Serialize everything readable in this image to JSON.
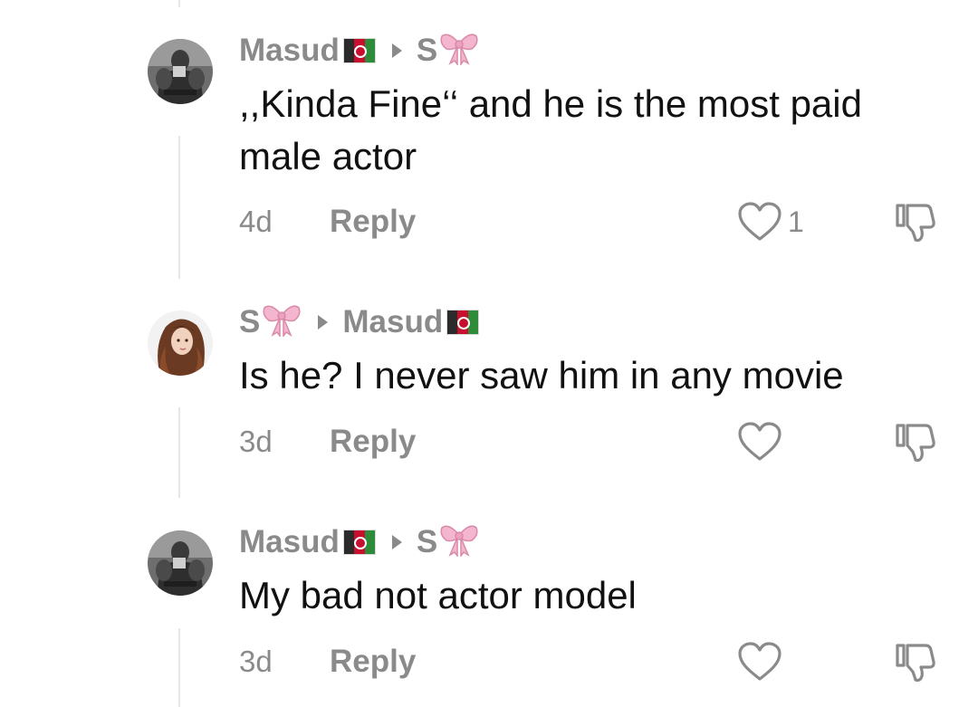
{
  "comments": [
    {
      "author": "Masud",
      "reply_to": "S",
      "author_flag_icon": "afghanistan-flag-icon",
      "reply_to_icon": "pink-bow-icon",
      "text": ",,Kinda Fine‘‘ and he is the most paid male actor",
      "time": "4d",
      "reply_label": "Reply",
      "like_count": "1"
    },
    {
      "author": "S",
      "reply_to": "Masud",
      "author_flag_icon": "pink-bow-icon",
      "reply_to_icon": "afghanistan-flag-icon",
      "text": "Is he? I never saw him in any movie",
      "time": "3d",
      "reply_label": "Reply",
      "like_count": ""
    },
    {
      "author": "Masud",
      "reply_to": "S",
      "author_flag_icon": "afghanistan-flag-icon",
      "reply_to_icon": "pink-bow-icon",
      "text": "My bad not actor model",
      "time": "3d",
      "reply_label": "Reply",
      "like_count": ""
    }
  ],
  "colors": {
    "secondary_text": "#8a8a8a",
    "primary_text": "#111111",
    "thread_line": "#e6e6e6",
    "bow_pink": "#f4b6cf"
  }
}
